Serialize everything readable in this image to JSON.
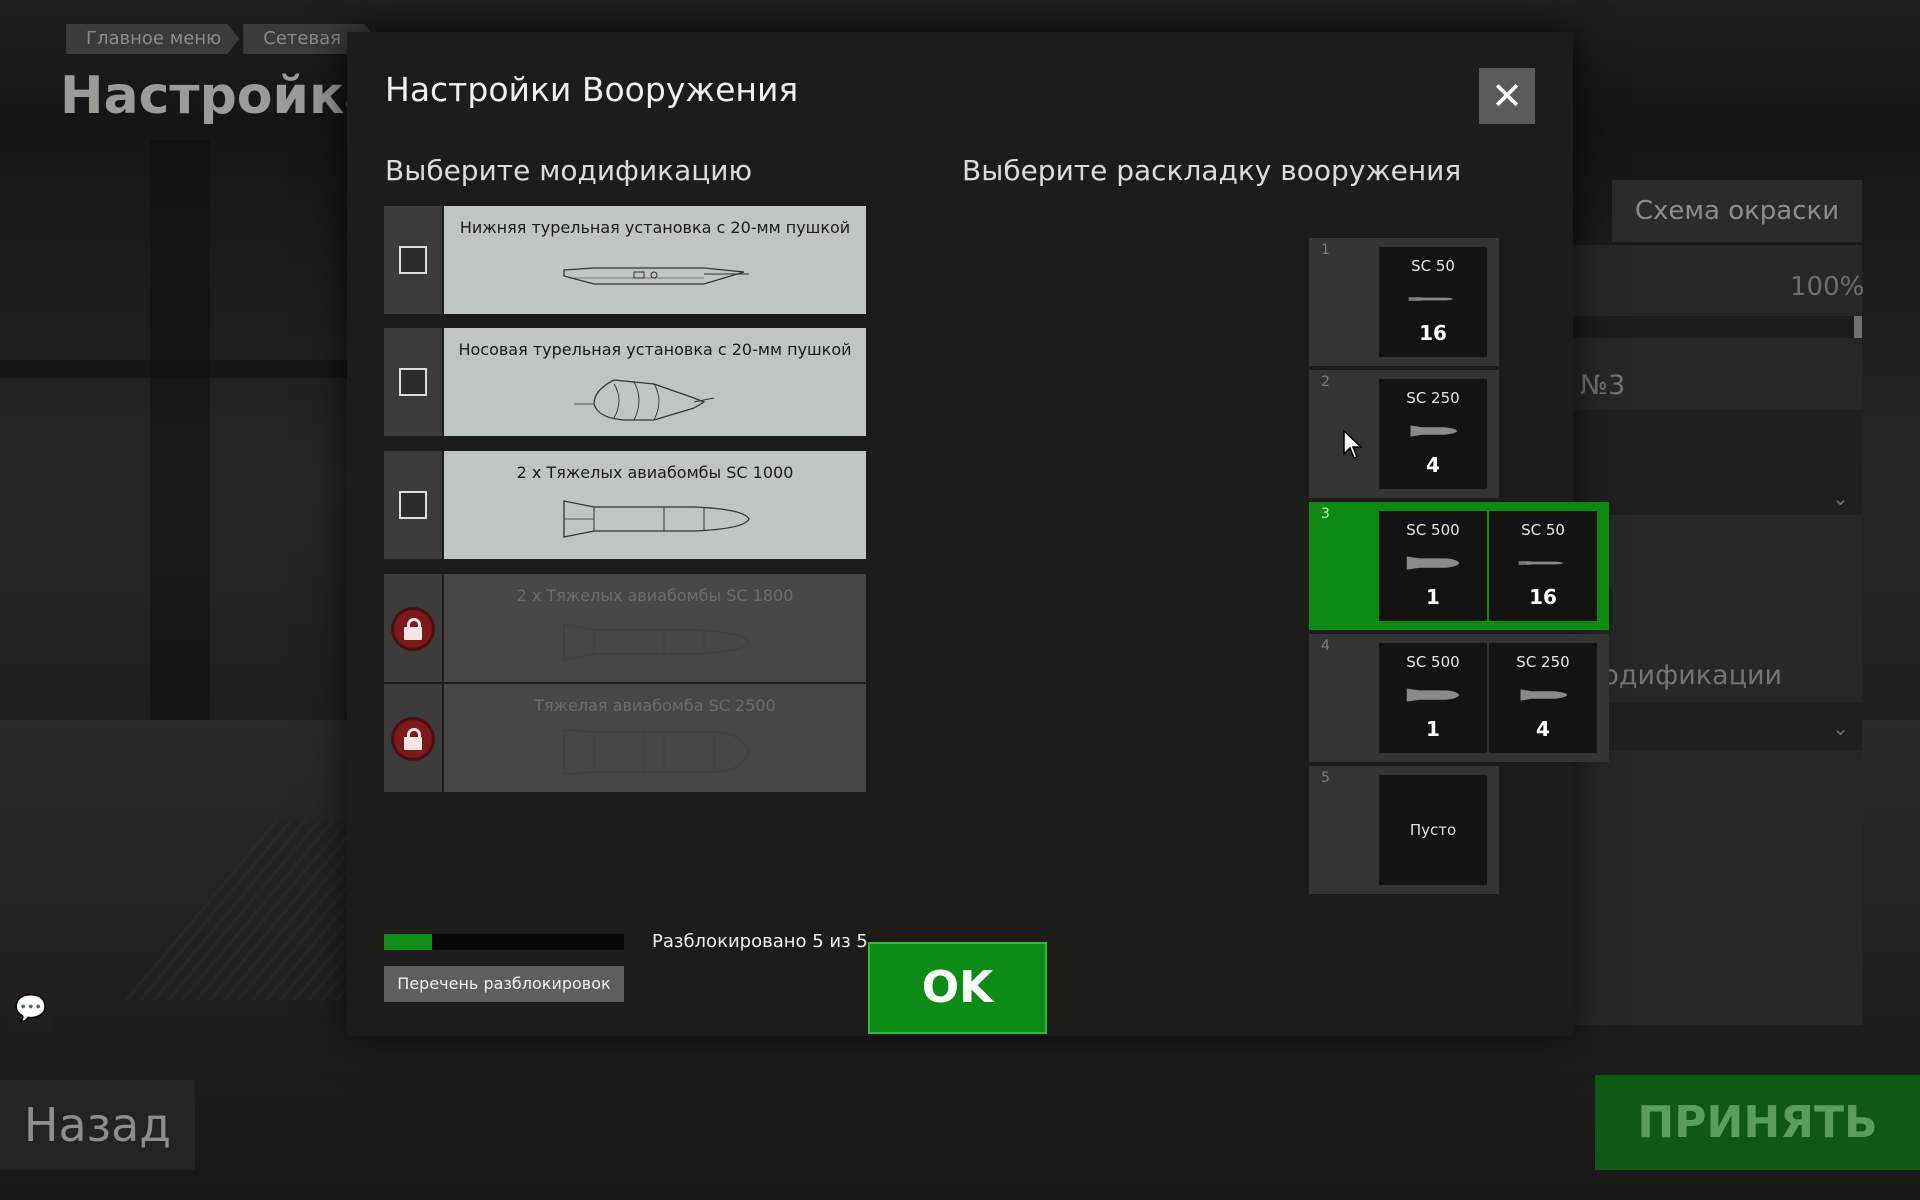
{
  "background": {
    "breadcrumb": [
      "Главное меню",
      "Сетевая и"
    ],
    "page_title": "Настройка с",
    "tab_paint": "Схема окраски",
    "percent": "100%",
    "number_fragment": "№3",
    "modifications_fragment": "модификации",
    "back_button": "Назад",
    "accept_button": "ПРИНЯТЬ"
  },
  "modal": {
    "title": "Настройки Вооружения",
    "close_icon": "close-icon",
    "modifications_title": "Выберите модификацию",
    "loadout_title": "Выберите раскладку вооружения",
    "modifications": [
      {
        "label": "Нижняя турельная установка с 20-мм пушкой",
        "state": "unchecked",
        "sketch": "ventral-turret"
      },
      {
        "label": "Носовая турельная установка с 20-мм пушкой",
        "state": "unchecked",
        "sketch": "nose-turret"
      },
      {
        "label": "2 x Тяжелых авиабомбы SC 1000",
        "state": "unchecked",
        "sketch": "bomb"
      },
      {
        "label": "2 x Тяжелых авиабомбы SC 1800",
        "state": "locked",
        "sketch": "bomb"
      },
      {
        "label": "Тяжелая авиабомба SC 2500",
        "state": "locked",
        "sketch": "bomb-large"
      }
    ],
    "loadouts": [
      {
        "num": "1",
        "active": false,
        "weapons": [
          {
            "name": "SC 50",
            "count": "16",
            "size": "small"
          }
        ]
      },
      {
        "num": "2",
        "active": false,
        "weapons": [
          {
            "name": "SC 250",
            "count": "4",
            "size": "medium"
          }
        ]
      },
      {
        "num": "3",
        "active": true,
        "weapons": [
          {
            "name": "SC 500",
            "count": "1",
            "size": "large"
          },
          {
            "name": "SC 50",
            "count": "16",
            "size": "small"
          }
        ]
      },
      {
        "num": "4",
        "active": false,
        "weapons": [
          {
            "name": "SC 500",
            "count": "1",
            "size": "large"
          },
          {
            "name": "SC 250",
            "count": "4",
            "size": "medium"
          }
        ]
      },
      {
        "num": "5",
        "active": false,
        "weapons": [
          {
            "empty": "Пусто"
          }
        ]
      }
    ],
    "unlock_progress": 0.2,
    "unlock_text": "Разблокировано 5 из 5",
    "unlock_list_button": "Перечень разблокировок",
    "ok_button": "OK"
  },
  "colors": {
    "accent_green": "#0d8c15",
    "locked_red": "#7a1a1a",
    "card_unlocked": "#bfc6bf"
  }
}
